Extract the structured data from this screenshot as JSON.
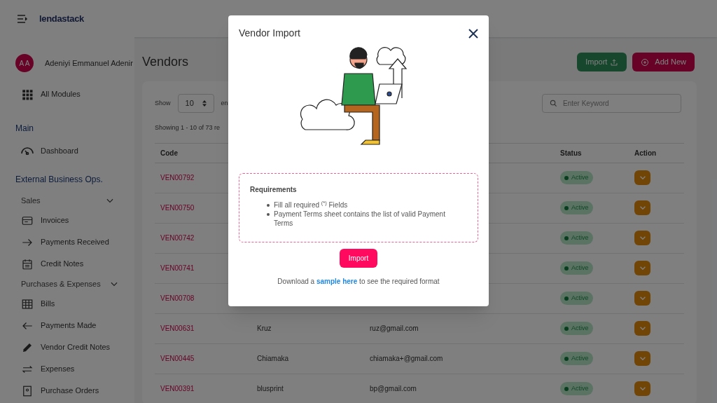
{
  "header": {
    "logo": "lendastack"
  },
  "user": {
    "initials": "A A",
    "name": "Adeniyi Emmanuel Adenir"
  },
  "sidebar": [
    {
      "kind": "module",
      "label": "All Modules"
    },
    {
      "kind": "section",
      "label": "Main"
    },
    {
      "kind": "item",
      "label": "Dashboard"
    },
    {
      "kind": "section",
      "label": "External Business Ops."
    },
    {
      "kind": "group",
      "label": "Sales",
      "expanded": true
    },
    {
      "kind": "item",
      "label": "Invoices"
    },
    {
      "kind": "item",
      "label": "Payments Received"
    },
    {
      "kind": "item",
      "label": "Credit Notes"
    },
    {
      "kind": "group",
      "label": "Purchases & Expenses",
      "expanded": true
    },
    {
      "kind": "item",
      "label": "Bills"
    },
    {
      "kind": "item",
      "label": "Payments Made"
    },
    {
      "kind": "item",
      "label": "Vendor Credit Notes"
    },
    {
      "kind": "item",
      "label": "Expenses"
    },
    {
      "kind": "item",
      "label": "Purchase Orders"
    }
  ],
  "page": {
    "title": "Vendors",
    "import_button": "Import",
    "add_button": "Add New"
  },
  "table_controls": {
    "show_label": "Show",
    "page_size": "10",
    "entries_label": "en",
    "search_placeholder": "Enter Keyword",
    "showing": "Showing 1 - 10 of 73 re"
  },
  "table": {
    "columns": [
      {
        "kind": "code",
        "label": "Code"
      },
      {
        "kind": "status",
        "label": "Status"
      },
      {
        "kind": "action",
        "label": "Action"
      }
    ],
    "rows": [
      {
        "code": "VEN00792",
        "status": "Active"
      },
      {
        "code": "VEN00750",
        "status": "Active"
      },
      {
        "code": "VEN00742",
        "status": "Active"
      },
      {
        "code": "VEN00741",
        "status": "Active"
      },
      {
        "code": "VEN00708",
        "status": "Active"
      },
      {
        "code": "VEN00631",
        "name": "Kruz",
        "email": "ruz@gmail.com",
        "status": "Active"
      },
      {
        "code": "VEN00445",
        "name": "Chiamaka",
        "email": "chiamaka+@gmail.com",
        "status": "Active"
      },
      {
        "code": "VEN00391",
        "name": "blusprint",
        "email": "bp@gmail.com",
        "status": "Active"
      }
    ]
  },
  "modal": {
    "title": "Vendor Import",
    "requirements_title": "Requirements",
    "requirements": [
      "Fill all required $^{(*)}$ Fields",
      "Payment Terms sheet contains the list of valid Payment Terms"
    ],
    "import_button": "Import",
    "hint_before": "Download a",
    "hint_link": "sample here",
    "hint_after": "to see the required format"
  }
}
